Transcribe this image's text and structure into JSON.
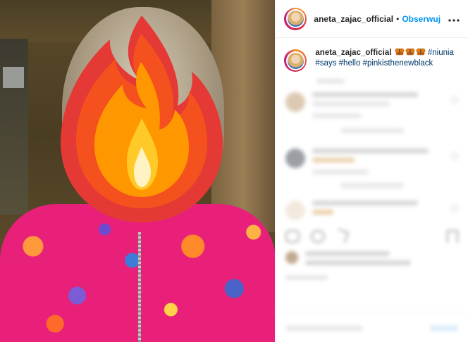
{
  "post": {
    "username": "aneta_zajac_official",
    "separator": "•",
    "follow_label": "Obserwuj",
    "more_icon": "more-horizontal-icon",
    "more_label": "•••"
  },
  "caption": {
    "username": "aneta_zajac_official",
    "emoji": [
      "butterfly-emoji",
      "butterfly-emoji",
      "butterfly-emoji"
    ],
    "hashtags": [
      "#niunia",
      "#says",
      "#hello",
      "#pinkisthenewblack"
    ]
  },
  "colors": {
    "link": "#0095f6",
    "hashtag": "#00376b",
    "text": "#262626",
    "divider": "#efefef"
  },
  "photo": {
    "sticker": "fire-emoji"
  }
}
